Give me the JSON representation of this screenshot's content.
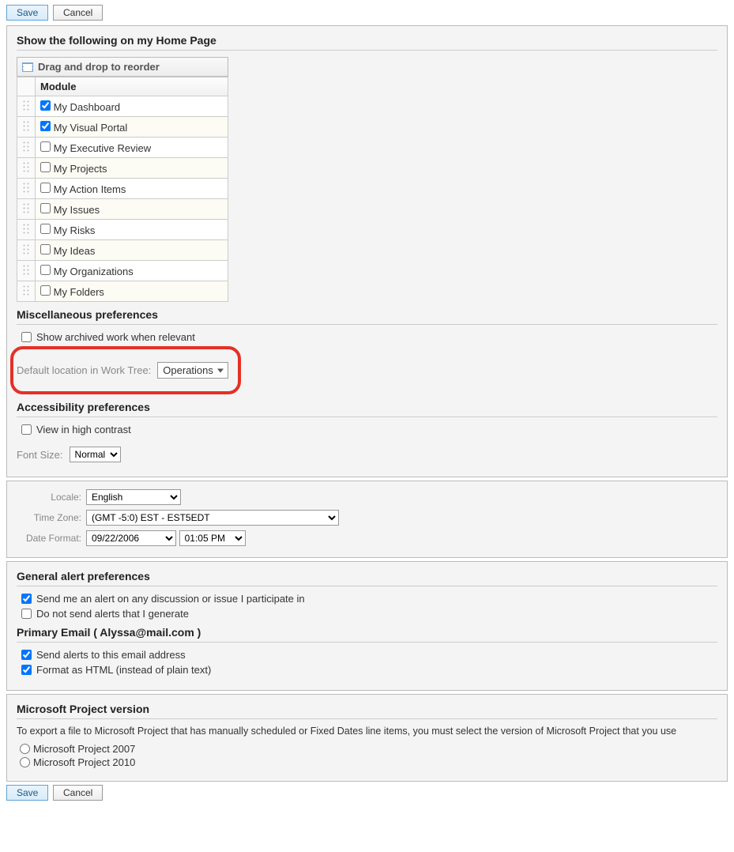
{
  "buttons": {
    "save": "Save",
    "cancel": "Cancel"
  },
  "home_modules": {
    "title": "Show the following on my Home Page",
    "reorder_hint": "Drag and drop to reorder",
    "column_header": "Module",
    "items": [
      {
        "label": "My Dashboard",
        "checked": true
      },
      {
        "label": "My Visual Portal",
        "checked": true
      },
      {
        "label": "My Executive Review",
        "checked": false
      },
      {
        "label": "My Projects",
        "checked": false
      },
      {
        "label": "My Action Items",
        "checked": false
      },
      {
        "label": "My Issues",
        "checked": false
      },
      {
        "label": "My Risks",
        "checked": false
      },
      {
        "label": "My Ideas",
        "checked": false
      },
      {
        "label": "My Organizations",
        "checked": false
      },
      {
        "label": "My Folders",
        "checked": false
      }
    ]
  },
  "misc": {
    "title": "Miscellaneous preferences",
    "show_archived": {
      "label": "Show archived work when relevant",
      "checked": false
    },
    "default_location_label": "Default location in Work Tree:",
    "default_location_value": "Operations"
  },
  "accessibility": {
    "title": "Accessibility preferences",
    "high_contrast": {
      "label": "View in high contrast",
      "checked": false
    },
    "font_size_label": "Font Size:",
    "font_size_value": "Normal"
  },
  "locale_panel": {
    "locale_label": "Locale:",
    "locale_value": "English",
    "timezone_label": "Time Zone:",
    "timezone_value": "(GMT -5:0) EST - EST5EDT",
    "dateformat_label": "Date Format:",
    "date_value": "09/22/2006",
    "time_value": "01:05 PM"
  },
  "alerts": {
    "title": "General alert preferences",
    "participate": {
      "label": "Send me an alert on any discussion or issue I participate in",
      "checked": true
    },
    "generate": {
      "label": "Do not send alerts that I generate",
      "checked": false
    },
    "primary_email_title": "Primary Email ( Alyssa@mail.com )",
    "send_to_email": {
      "label": "Send alerts to this email address",
      "checked": true
    },
    "format_html": {
      "label": "Format as HTML (instead of plain text)",
      "checked": true
    }
  },
  "msproject": {
    "title": "Microsoft Project version",
    "description": "To export a file to Microsoft Project that has manually scheduled or Fixed Dates line items, you must select the version of Microsoft Project that you use",
    "option_2007": "Microsoft Project 2007",
    "option_2010": "Microsoft Project 2010"
  }
}
